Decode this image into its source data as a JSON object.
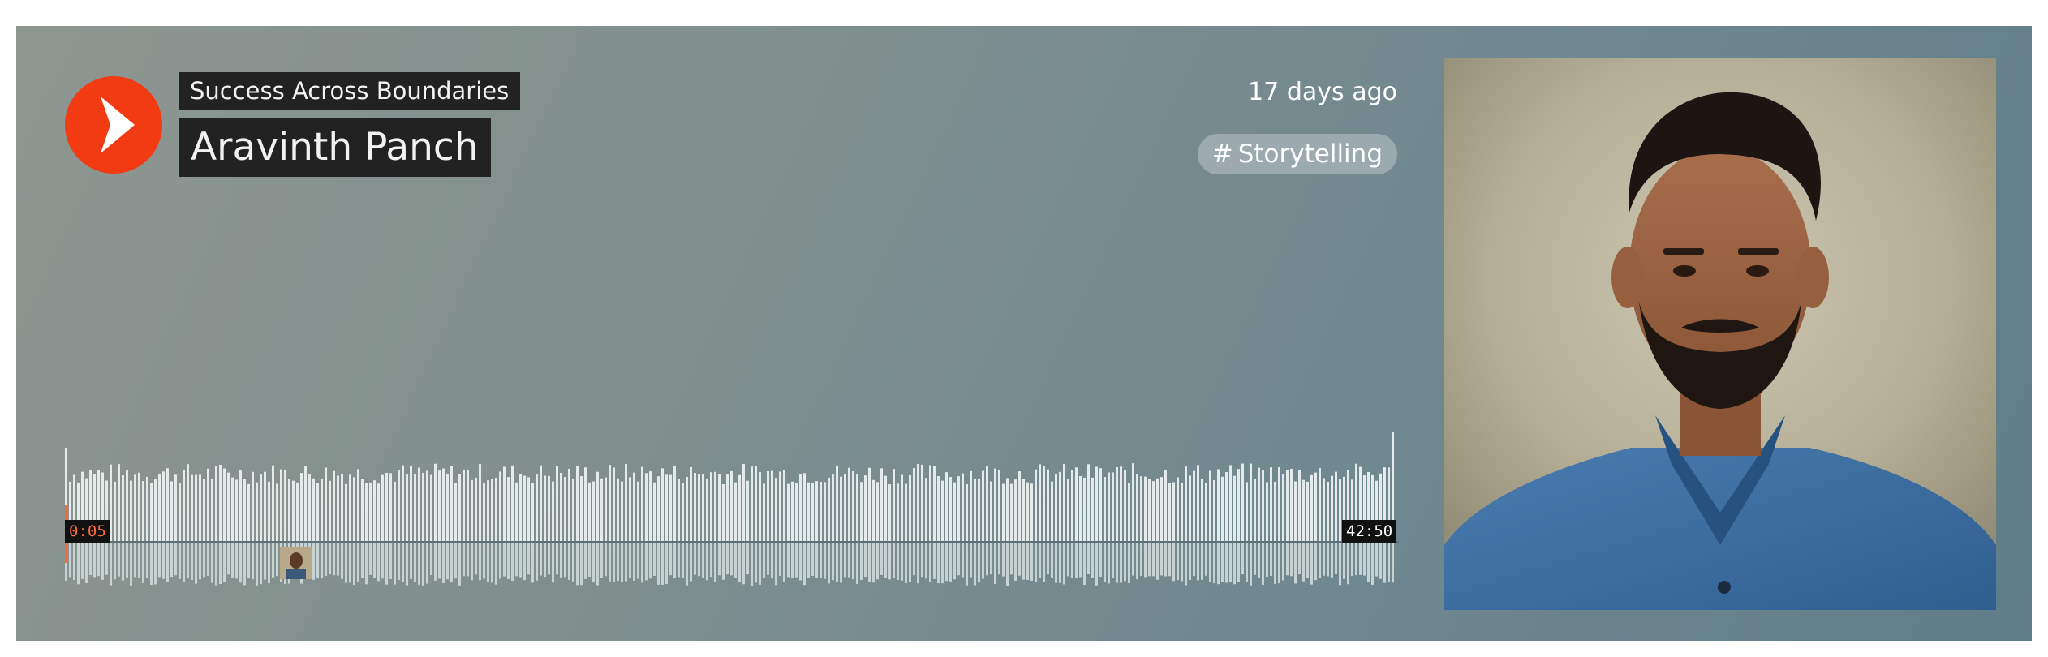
{
  "player": {
    "series": "Success Across Boundaries",
    "title": "Aravinth Panch",
    "posted": "17 days ago",
    "tag": {
      "hash": "#",
      "label": "Storytelling"
    },
    "current_time": "0:05",
    "duration": "42:50",
    "progress_fraction": 0.002,
    "play_icon": "play-icon",
    "accent_color": "#f23b12",
    "progress_color": "#ff6a3a"
  }
}
